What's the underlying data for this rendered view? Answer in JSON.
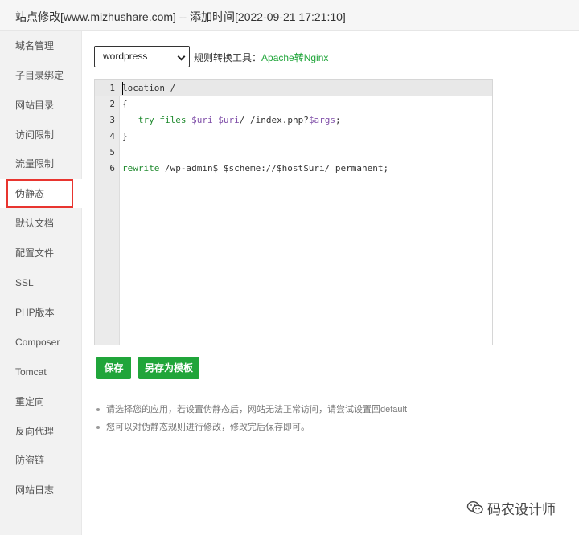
{
  "window": {
    "title": "站点修改[www.mizhushare.com] -- 添加时间[2022-09-21 17:21:10]"
  },
  "sidebar": {
    "items": [
      {
        "label": "域名管理",
        "active": false
      },
      {
        "label": "子目录绑定",
        "active": false
      },
      {
        "label": "网站目录",
        "active": false
      },
      {
        "label": "访问限制",
        "active": false
      },
      {
        "label": "流量限制",
        "active": false
      },
      {
        "label": "伪静态",
        "active": true
      },
      {
        "label": "默认文档",
        "active": false
      },
      {
        "label": "配置文件",
        "active": false
      },
      {
        "label": "SSL",
        "active": false
      },
      {
        "label": "PHP版本",
        "active": false
      },
      {
        "label": "Composer",
        "active": false
      },
      {
        "label": "Tomcat",
        "active": false
      },
      {
        "label": "重定向",
        "active": false
      },
      {
        "label": "反向代理",
        "active": false
      },
      {
        "label": "防盗链",
        "active": false
      },
      {
        "label": "网站日志",
        "active": false
      }
    ]
  },
  "rewrite": {
    "template_select": "wordpress",
    "tool_label": "规则转换工具：",
    "tool_link": "Apache转Nginx"
  },
  "editor": {
    "line_numbers": [
      "1",
      "2",
      "3",
      "4",
      "5",
      "6"
    ],
    "lines": {
      "l1": {
        "text": "location /"
      },
      "l2": {
        "text": "{"
      },
      "l3": {
        "indent": "   ",
        "kw": "try_files",
        "sp1": " ",
        "v1": "$uri",
        "sp2": " ",
        "v2": "$uri",
        "t1": "/ /index.php?",
        "v3": "$args",
        "t2": ";"
      },
      "l4": {
        "text": "}"
      },
      "l5": {
        "text": ""
      },
      "l6": {
        "kw": "rewrite",
        "t1": " /wp-admin$ $scheme://$host$uri/ permanent;"
      }
    }
  },
  "buttons": {
    "save": "保存",
    "save_as_template": "另存为模板"
  },
  "tips": [
    "请选择您的应用，若设置伪静态后，网站无法正常访问，请尝试设置回default",
    "您可以对伪静态规则进行修改，修改完后保存即可。"
  ],
  "watermark": {
    "text": "码农设计师",
    "icon": "wechat-icon"
  },
  "colors": {
    "accent_green": "#20a53a",
    "highlight_red": "#e8352f"
  }
}
